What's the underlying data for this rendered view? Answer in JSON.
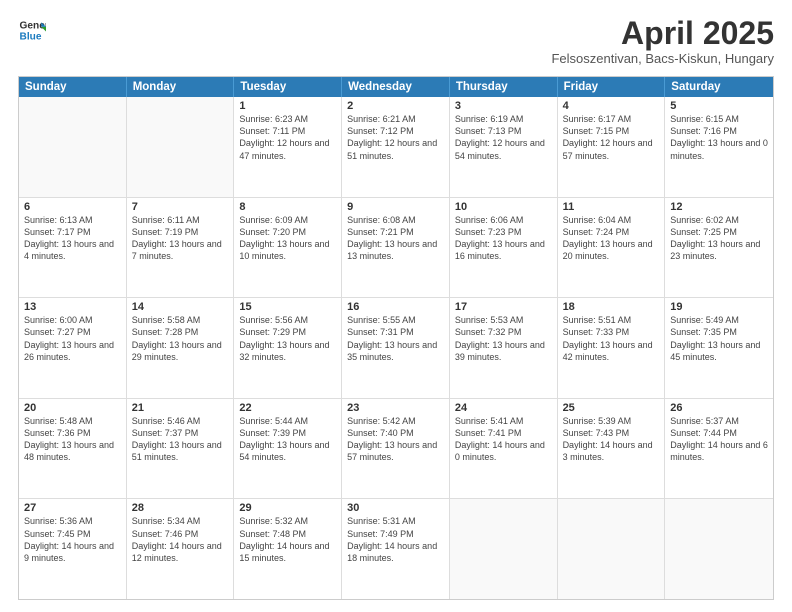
{
  "header": {
    "logo_line1": "General",
    "logo_line2": "Blue",
    "title": "April 2025",
    "subtitle": "Felsoszentivan, Bacs-Kiskun, Hungary"
  },
  "weekdays": [
    "Sunday",
    "Monday",
    "Tuesday",
    "Wednesday",
    "Thursday",
    "Friday",
    "Saturday"
  ],
  "weeks": [
    [
      {
        "day": "",
        "sunrise": "",
        "sunset": "",
        "daylight": ""
      },
      {
        "day": "",
        "sunrise": "",
        "sunset": "",
        "daylight": ""
      },
      {
        "day": "1",
        "sunrise": "Sunrise: 6:23 AM",
        "sunset": "Sunset: 7:11 PM",
        "daylight": "Daylight: 12 hours and 47 minutes."
      },
      {
        "day": "2",
        "sunrise": "Sunrise: 6:21 AM",
        "sunset": "Sunset: 7:12 PM",
        "daylight": "Daylight: 12 hours and 51 minutes."
      },
      {
        "day": "3",
        "sunrise": "Sunrise: 6:19 AM",
        "sunset": "Sunset: 7:13 PM",
        "daylight": "Daylight: 12 hours and 54 minutes."
      },
      {
        "day": "4",
        "sunrise": "Sunrise: 6:17 AM",
        "sunset": "Sunset: 7:15 PM",
        "daylight": "Daylight: 12 hours and 57 minutes."
      },
      {
        "day": "5",
        "sunrise": "Sunrise: 6:15 AM",
        "sunset": "Sunset: 7:16 PM",
        "daylight": "Daylight: 13 hours and 0 minutes."
      }
    ],
    [
      {
        "day": "6",
        "sunrise": "Sunrise: 6:13 AM",
        "sunset": "Sunset: 7:17 PM",
        "daylight": "Daylight: 13 hours and 4 minutes."
      },
      {
        "day": "7",
        "sunrise": "Sunrise: 6:11 AM",
        "sunset": "Sunset: 7:19 PM",
        "daylight": "Daylight: 13 hours and 7 minutes."
      },
      {
        "day": "8",
        "sunrise": "Sunrise: 6:09 AM",
        "sunset": "Sunset: 7:20 PM",
        "daylight": "Daylight: 13 hours and 10 minutes."
      },
      {
        "day": "9",
        "sunrise": "Sunrise: 6:08 AM",
        "sunset": "Sunset: 7:21 PM",
        "daylight": "Daylight: 13 hours and 13 minutes."
      },
      {
        "day": "10",
        "sunrise": "Sunrise: 6:06 AM",
        "sunset": "Sunset: 7:23 PM",
        "daylight": "Daylight: 13 hours and 16 minutes."
      },
      {
        "day": "11",
        "sunrise": "Sunrise: 6:04 AM",
        "sunset": "Sunset: 7:24 PM",
        "daylight": "Daylight: 13 hours and 20 minutes."
      },
      {
        "day": "12",
        "sunrise": "Sunrise: 6:02 AM",
        "sunset": "Sunset: 7:25 PM",
        "daylight": "Daylight: 13 hours and 23 minutes."
      }
    ],
    [
      {
        "day": "13",
        "sunrise": "Sunrise: 6:00 AM",
        "sunset": "Sunset: 7:27 PM",
        "daylight": "Daylight: 13 hours and 26 minutes."
      },
      {
        "day": "14",
        "sunrise": "Sunrise: 5:58 AM",
        "sunset": "Sunset: 7:28 PM",
        "daylight": "Daylight: 13 hours and 29 minutes."
      },
      {
        "day": "15",
        "sunrise": "Sunrise: 5:56 AM",
        "sunset": "Sunset: 7:29 PM",
        "daylight": "Daylight: 13 hours and 32 minutes."
      },
      {
        "day": "16",
        "sunrise": "Sunrise: 5:55 AM",
        "sunset": "Sunset: 7:31 PM",
        "daylight": "Daylight: 13 hours and 35 minutes."
      },
      {
        "day": "17",
        "sunrise": "Sunrise: 5:53 AM",
        "sunset": "Sunset: 7:32 PM",
        "daylight": "Daylight: 13 hours and 39 minutes."
      },
      {
        "day": "18",
        "sunrise": "Sunrise: 5:51 AM",
        "sunset": "Sunset: 7:33 PM",
        "daylight": "Daylight: 13 hours and 42 minutes."
      },
      {
        "day": "19",
        "sunrise": "Sunrise: 5:49 AM",
        "sunset": "Sunset: 7:35 PM",
        "daylight": "Daylight: 13 hours and 45 minutes."
      }
    ],
    [
      {
        "day": "20",
        "sunrise": "Sunrise: 5:48 AM",
        "sunset": "Sunset: 7:36 PM",
        "daylight": "Daylight: 13 hours and 48 minutes."
      },
      {
        "day": "21",
        "sunrise": "Sunrise: 5:46 AM",
        "sunset": "Sunset: 7:37 PM",
        "daylight": "Daylight: 13 hours and 51 minutes."
      },
      {
        "day": "22",
        "sunrise": "Sunrise: 5:44 AM",
        "sunset": "Sunset: 7:39 PM",
        "daylight": "Daylight: 13 hours and 54 minutes."
      },
      {
        "day": "23",
        "sunrise": "Sunrise: 5:42 AM",
        "sunset": "Sunset: 7:40 PM",
        "daylight": "Daylight: 13 hours and 57 minutes."
      },
      {
        "day": "24",
        "sunrise": "Sunrise: 5:41 AM",
        "sunset": "Sunset: 7:41 PM",
        "daylight": "Daylight: 14 hours and 0 minutes."
      },
      {
        "day": "25",
        "sunrise": "Sunrise: 5:39 AM",
        "sunset": "Sunset: 7:43 PM",
        "daylight": "Daylight: 14 hours and 3 minutes."
      },
      {
        "day": "26",
        "sunrise": "Sunrise: 5:37 AM",
        "sunset": "Sunset: 7:44 PM",
        "daylight": "Daylight: 14 hours and 6 minutes."
      }
    ],
    [
      {
        "day": "27",
        "sunrise": "Sunrise: 5:36 AM",
        "sunset": "Sunset: 7:45 PM",
        "daylight": "Daylight: 14 hours and 9 minutes."
      },
      {
        "day": "28",
        "sunrise": "Sunrise: 5:34 AM",
        "sunset": "Sunset: 7:46 PM",
        "daylight": "Daylight: 14 hours and 12 minutes."
      },
      {
        "day": "29",
        "sunrise": "Sunrise: 5:32 AM",
        "sunset": "Sunset: 7:48 PM",
        "daylight": "Daylight: 14 hours and 15 minutes."
      },
      {
        "day": "30",
        "sunrise": "Sunrise: 5:31 AM",
        "sunset": "Sunset: 7:49 PM",
        "daylight": "Daylight: 14 hours and 18 minutes."
      },
      {
        "day": "",
        "sunrise": "",
        "sunset": "",
        "daylight": ""
      },
      {
        "day": "",
        "sunrise": "",
        "sunset": "",
        "daylight": ""
      },
      {
        "day": "",
        "sunrise": "",
        "sunset": "",
        "daylight": ""
      }
    ]
  ]
}
